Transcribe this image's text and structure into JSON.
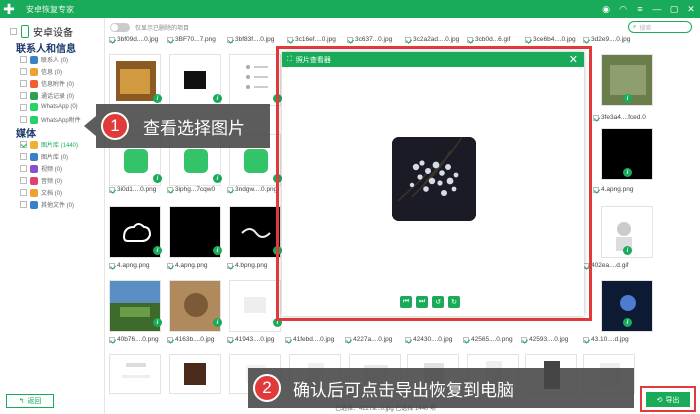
{
  "window": {
    "title": "安卓恢复专家",
    "controls": [
      "chat-icon",
      "wifi-icon",
      "menu-icon",
      "minimize-icon",
      "maximize-icon",
      "close-icon"
    ]
  },
  "sidebar": {
    "device": "安卓设备",
    "categories": [
      {
        "name": "联系人和信息",
        "items": [
          {
            "label": "联系人 (0)",
            "color": "#3b82c4"
          },
          {
            "label": "信息 (0)",
            "color": "#f0a030"
          },
          {
            "label": "信息附件 (0)",
            "color": "#f06030"
          },
          {
            "label": "通话记录 (0)",
            "color": "#2fa050"
          },
          {
            "label": "WhatsApp (0)",
            "color": "#25d366"
          },
          {
            "label": "WhatsApp附件",
            "color": "#25d366"
          }
        ]
      },
      {
        "name": "媒体",
        "items": [
          {
            "label": "图片库 (1440)",
            "color": "#f0b030",
            "checked": true,
            "active": true
          },
          {
            "label": "图片库 (0)",
            "color": "#3b82c4"
          },
          {
            "label": "视频 (0)",
            "color": "#8a4fd0"
          },
          {
            "label": "音频 (0)",
            "color": "#e04070"
          },
          {
            "label": "文档 (0)",
            "color": "#f0a030"
          },
          {
            "label": "其他文件 (0)",
            "color": "#3b82c4"
          }
        ]
      }
    ],
    "back_label": "返回"
  },
  "toolbar": {
    "toggle_label": "仅显示已删除的项目",
    "search_placeholder": "搜索"
  },
  "top_filenames": [
    "3bf09d....0.jpg",
    "3BF70...7.png",
    "3bf83f....0.jpg",
    "3c16ef....0.jpg",
    "3c637...0.jpg",
    "3c2a2ad....0.jpg",
    "3cb0d...6.gif",
    "3ce6b4....0.jpg",
    "3d2e9....0.jpg"
  ],
  "rows": [
    {
      "labels": [
        "",
        "",
        "",
        "",
        "",
        "",
        "",
        "",
        "3fe3a4....fced.0"
      ]
    },
    {
      "labels": [
        "3i0d1....0.png",
        "3iphg...7cqw0",
        "3ndgw....0.png",
        "",
        "",
        "",
        "",
        "",
        "4.apng.png"
      ]
    },
    {
      "labels": [
        "4.apng.png",
        "4.apng.png",
        "4.bpng.png",
        "",
        "",
        "",
        "",
        "",
        "402ea....d.gif"
      ]
    },
    {
      "labels": [
        "40b76....0.png",
        "4163b....0.jpg",
        "41943....0.jpg",
        "41febd....0.jpg",
        "4227a....0.jpg",
        "42430....0.jpg",
        "42565....0.png",
        "42593....0.jpg",
        "43.10....d.jpg"
      ]
    }
  ],
  "status_text": "已选择：4227a...0.jpg 已选择 1440 项",
  "export_label": "导出",
  "viewer": {
    "title": "照片查看器",
    "buttons": [
      "first-icon",
      "last-icon",
      "rotate-left-icon",
      "rotate-right-icon"
    ]
  },
  "callouts": [
    {
      "num": "1",
      "text": "查看选择图片"
    },
    {
      "num": "2",
      "text": "确认后可点击导出恢复到电脑"
    }
  ],
  "colors": {
    "accent": "#1aab5a",
    "highlight": "#e03a3a"
  }
}
